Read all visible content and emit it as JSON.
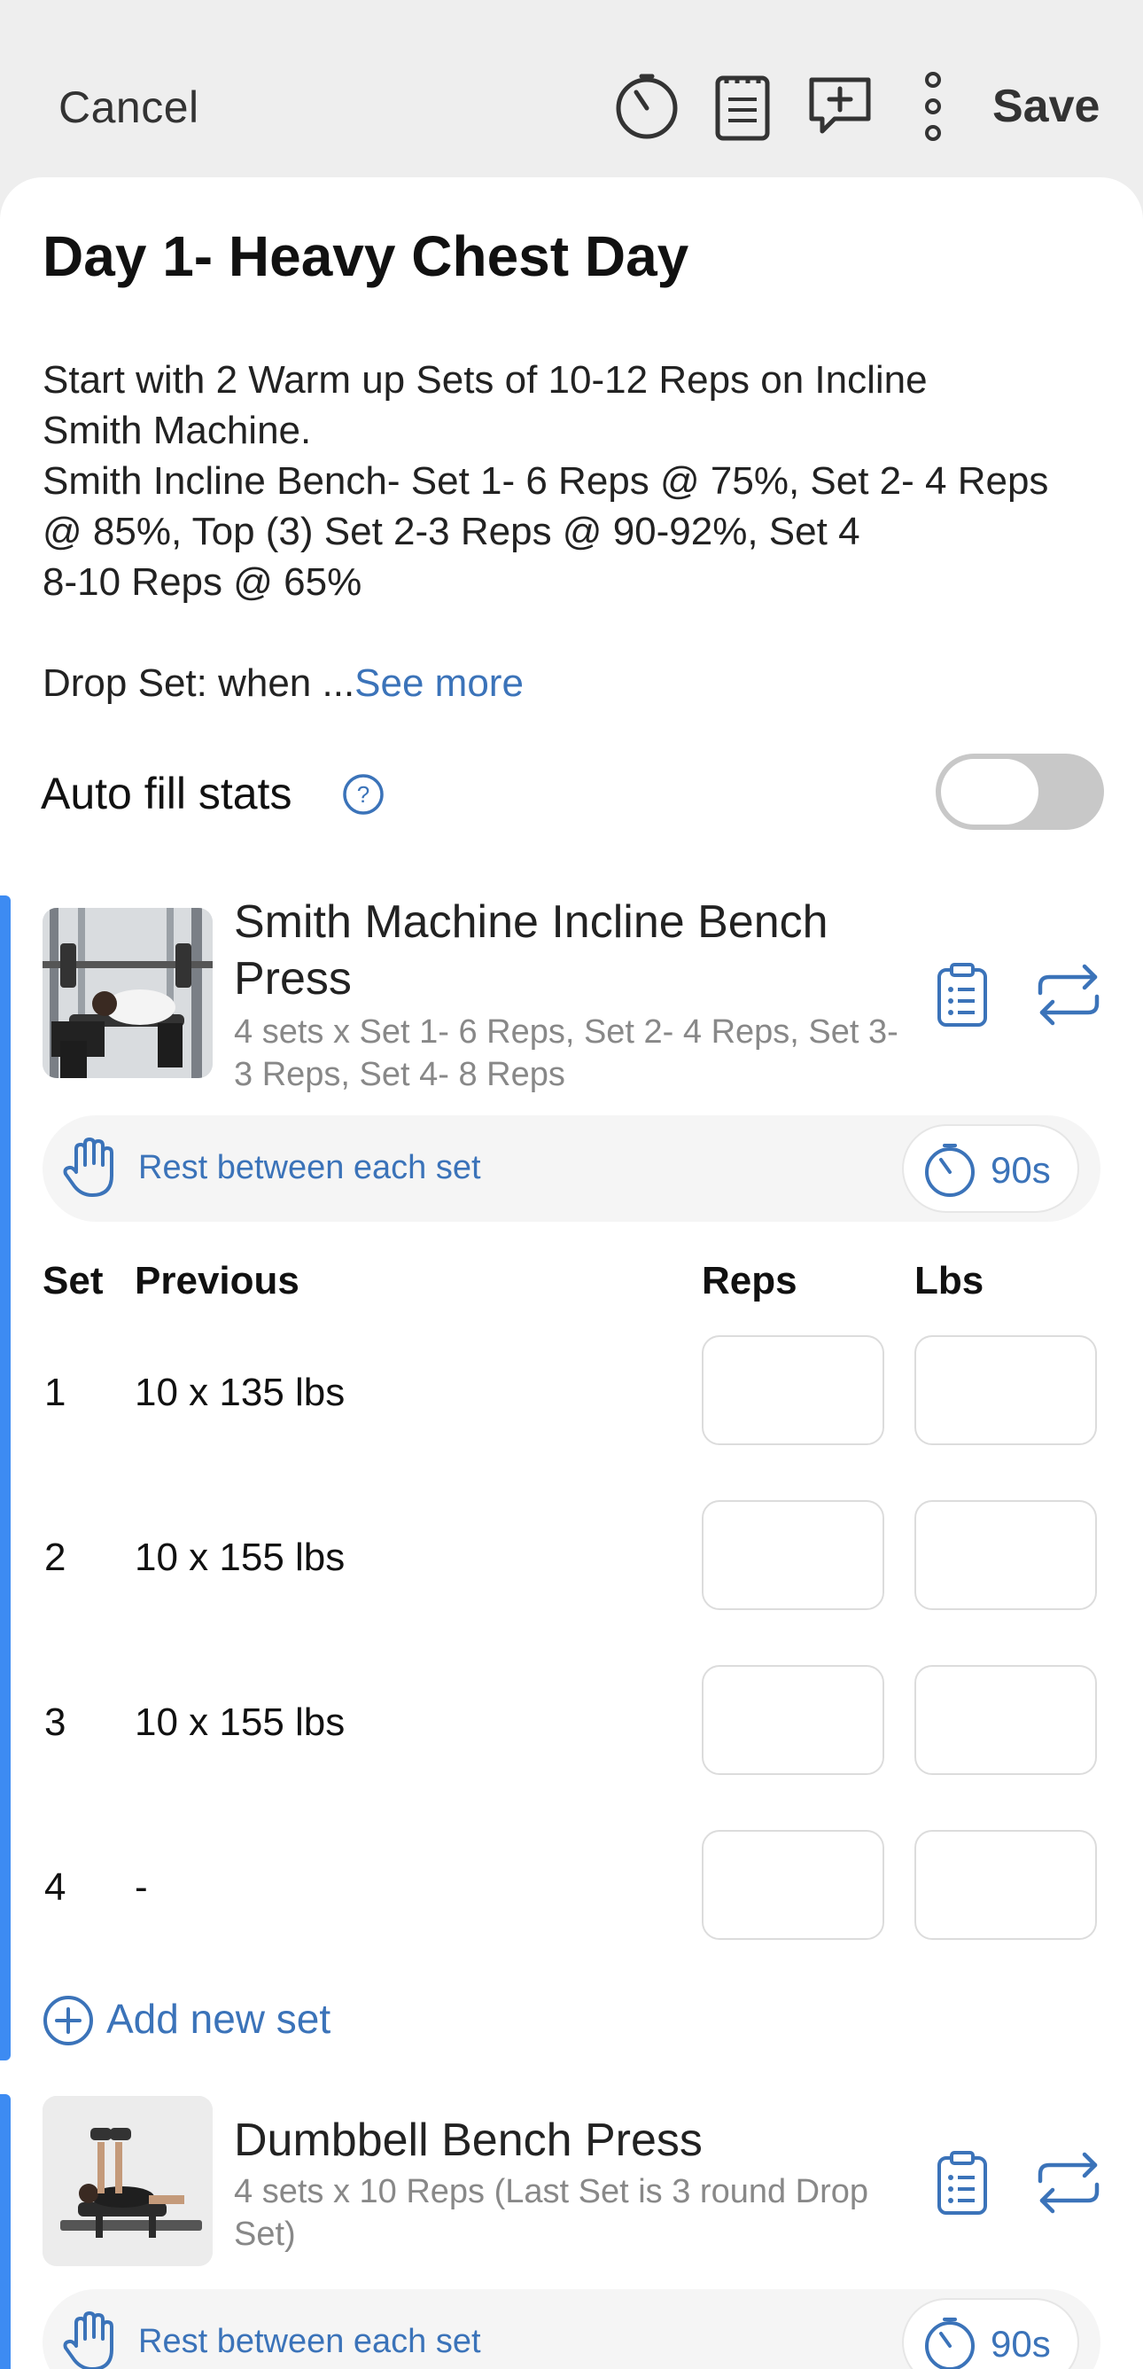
{
  "topbar": {
    "cancel_label": "Cancel",
    "save_label": "Save",
    "icons": [
      "timer-icon",
      "notes-icon",
      "add-comment-icon",
      "more-vertical-icon"
    ]
  },
  "workout": {
    "title": "Day 1- Heavy Chest Day",
    "description_lines": [
      "Start with 2 Warm up Sets of 10-12 Reps on Incline",
      "Smith Machine.",
      "Smith Incline Bench- Set 1- 6 Reps @ 75%, Set 2- 4 Reps",
      "@ 85%, Top (3) Set 2-3 Reps @ 90-92%, Set 4",
      "8-10 Reps @ 65%"
    ],
    "description_truncated": "Drop Set: when ...",
    "see_more_label": "See more"
  },
  "autofill": {
    "label": "Auto fill stats",
    "enabled": false
  },
  "colors": {
    "accent_blue": "#3b73b9",
    "sidebar_blue": "#3d8bf2",
    "toggle_off": "#c8c8c8"
  },
  "exercises": [
    {
      "name": "Smith Machine Incline Bench Press",
      "name_line1": "Smith Machine Incline Bench",
      "name_line2": "Press",
      "subtitle_line1": "4 sets x Set 1- 6 Reps, Set 2- 4 Reps, Set 3-",
      "subtitle_line2": "3 Reps, Set 4- 8 Reps",
      "rest_label": "Rest between each set",
      "rest_value": "90s",
      "columns": {
        "set": "Set",
        "previous": "Previous",
        "reps": "Reps",
        "lbs": "Lbs"
      },
      "sets": [
        {
          "set": "1",
          "previous": "10 x 135 lbs",
          "reps": "",
          "lbs": ""
        },
        {
          "set": "2",
          "previous": "10 x 155 lbs",
          "reps": "",
          "lbs": ""
        },
        {
          "set": "3",
          "previous": "10 x 155 lbs",
          "reps": "",
          "lbs": ""
        },
        {
          "set": "4",
          "previous": "-",
          "reps": "",
          "lbs": ""
        }
      ],
      "add_set_label": "Add new set"
    },
    {
      "name": "Dumbbell Bench Press",
      "subtitle_line1": "4 sets x 10 Reps (Last Set is 3 round Drop",
      "subtitle_line2": "Set)",
      "rest_label": "Rest between each set",
      "rest_value": "90s"
    }
  ]
}
